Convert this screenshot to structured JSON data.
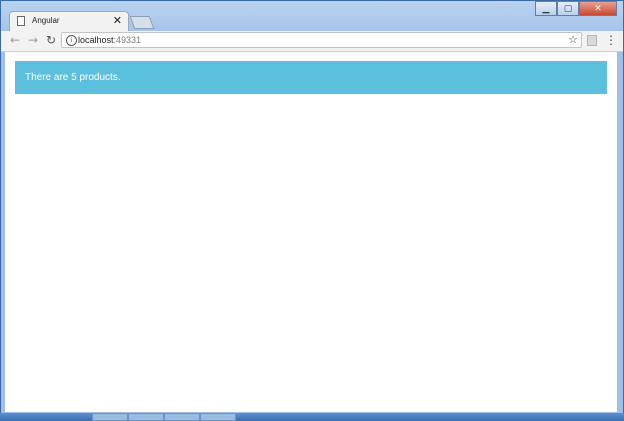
{
  "browser": {
    "tab_title": "Angular",
    "tab_close": "✕",
    "url_host": "localhost",
    "url_port": ":49331"
  },
  "page": {
    "message": "There are 5 products."
  },
  "colors": {
    "alert_bg": "#5bc0de",
    "alert_text": "#ffffff"
  },
  "icons": {
    "back": "back-arrow-icon",
    "forward": "forward-arrow-icon",
    "reload": "reload-icon",
    "info": "info-icon",
    "bookmark": "star-icon",
    "menu": "kebab-menu-icon"
  }
}
